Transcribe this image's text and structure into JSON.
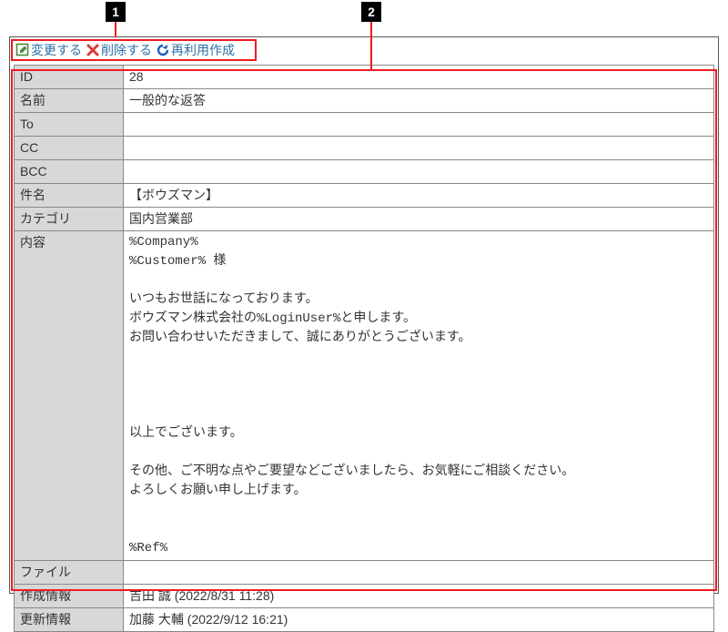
{
  "callouts": {
    "one": "1",
    "two": "2"
  },
  "toolbar": {
    "edit_label": "変更する",
    "delete_label": "削除する",
    "reuse_label": "再利用作成"
  },
  "fields": {
    "id_label": "ID",
    "id_value": "28",
    "name_label": "名前",
    "name_value": "一般的な返答",
    "to_label": "To",
    "to_value": "",
    "cc_label": "CC",
    "cc_value": "",
    "bcc_label": "BCC",
    "bcc_value": "",
    "subject_label": "件名",
    "subject_value": "【ボウズマン】",
    "category_label": "カテゴリ",
    "category_value": "国内営業部",
    "content_label": "内容",
    "content_value": "%Company%\n%Customer% 様\n\nいつもお世話になっております。\nボウズマン株式会社の%LoginUser%と申します。\nお問い合わせいただきまして、誠にありがとうございます。\n\n\n\n\n以上でございます。\n\nその他、ご不明な点やご要望などございましたら、お気軽にご相談ください。\nよろしくお願い申し上げます。\n\n\n%Ref%",
    "file_label": "ファイル",
    "file_value": "",
    "created_label": "作成情報",
    "created_value": "吉田 誠 (2022/8/31 11:28)",
    "updated_label": "更新情報",
    "updated_value": "加藤 大輔 (2022/9/12 16:21)"
  }
}
